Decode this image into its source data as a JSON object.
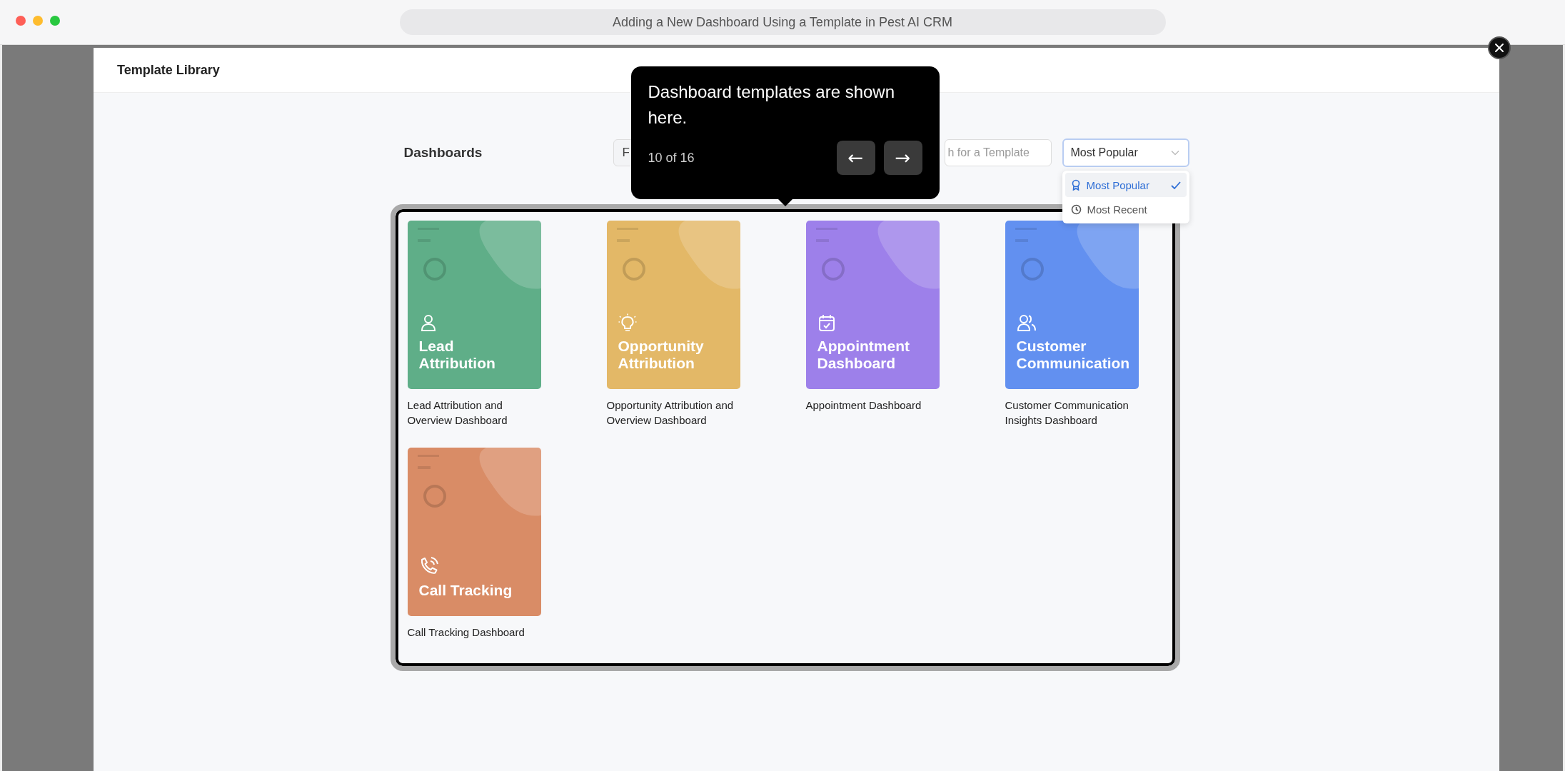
{
  "browser": {
    "title": "Adding a New Dashboard Using a Template in Pest AI CRM"
  },
  "modal": {
    "title": "Template Library"
  },
  "toolbar": {
    "heading": "Dashboards",
    "filter_label": "F",
    "search": {
      "placeholder": "h for a Template"
    },
    "sort": {
      "value": "Most Popular",
      "options": [
        {
          "label": "Most Popular",
          "kind": "popular",
          "selected": true
        },
        {
          "label": "Most Recent",
          "kind": "recent",
          "selected": false
        }
      ]
    }
  },
  "tooltip": {
    "text": "Dashboard templates are shown here.",
    "progress": "10 of 16",
    "prev": "←",
    "next": "→"
  },
  "templates": [
    {
      "title": "Lead Attribution",
      "caption": "Lead Attribution and Overview Dashboard",
      "kind": "person",
      "color": "#5fae88"
    },
    {
      "title": "Opportunity Attribution",
      "caption": "Opportunity Attribution and Overview Dashboard",
      "kind": "bulb",
      "color": "#e3b867"
    },
    {
      "title": "Appointment Dashboard",
      "caption": "Appointment Dashboard",
      "kind": "calendar",
      "color": "#9d80ea"
    },
    {
      "title": "Customer Communication",
      "caption": "Customer Communication Insights Dashboard",
      "kind": "people",
      "color": "#6290f0"
    },
    {
      "title": "Call Tracking",
      "caption": "Call Tracking Dashboard",
      "kind": "phone",
      "color": "#d98c66"
    }
  ]
}
